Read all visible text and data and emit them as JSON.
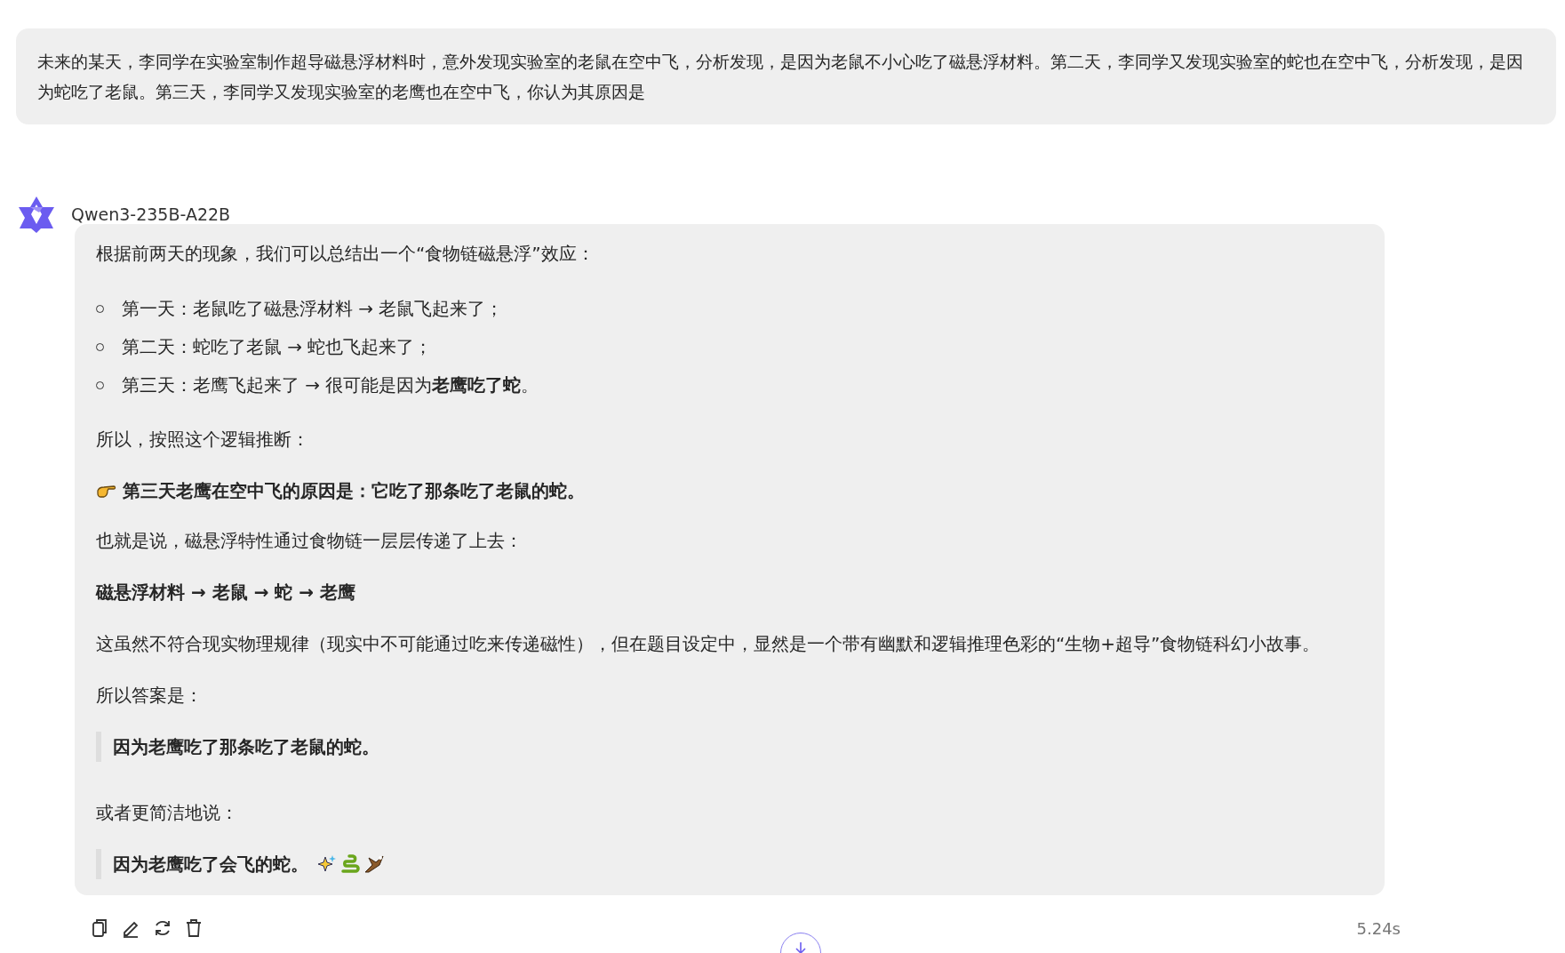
{
  "user_message": {
    "text": "未来的某天，李同学在实验室制作超导磁悬浮材料时，意外发现实验室的老鼠在空中飞，分析发现，是因为老鼠不小心吃了磁悬浮材料。第二天，李同学又发现实验室的蛇也在空中飞，分析发现，是因为蛇吃了老鼠。第三天，李同学又发现实验室的老鹰也在空中飞，你认为其原因是"
  },
  "assistant": {
    "name": "Qwen3-235B-A22B",
    "blocks": [
      {
        "kind": "paragraph",
        "text": "根据前两天的现象，我们可以总结出一个“食物链磁悬浮”效应："
      },
      {
        "kind": "bullets",
        "items": [
          "第一天：老鼠吃了磁悬浮材料 → 老鼠飞起来了；",
          "第二天：蛇吃了老鼠 → 蛇也飞起来了；",
          "第三天：老鹰飞起来了 → 很可能是因为**老鹰吃了蛇**。"
        ]
      },
      {
        "kind": "paragraph",
        "text": "所以，按照这个逻辑推断："
      },
      {
        "kind": "pointer",
        "text": "第三天老鹰在空中飞的原因是：它吃了那条吃了老鼠的蛇。"
      },
      {
        "kind": "paragraph",
        "text": "也就是说，磁悬浮特性通过食物链一层层传递了上去："
      },
      {
        "kind": "strong",
        "text": "磁悬浮材料 → 老鼠 → 蛇 → 老鹰"
      },
      {
        "kind": "paragraph",
        "text": "这虽然不符合现实物理规律（现实中不可能通过吃来传递磁性），但在题目设定中，显然是一个带有幽默和逻辑推理色彩的“生物+超导”食物链科幻小故事。"
      },
      {
        "kind": "paragraph",
        "text": "所以答案是："
      },
      {
        "kind": "quote",
        "text": "因为老鹰吃了那条吃了老鼠的蛇。",
        "emoji": false
      },
      {
        "kind": "paragraph",
        "text": "或者更简洁地说："
      },
      {
        "kind": "quote",
        "text": "因为老鹰吃了会飞的蛇。",
        "emoji": true
      }
    ],
    "duration": "5.24s"
  }
}
